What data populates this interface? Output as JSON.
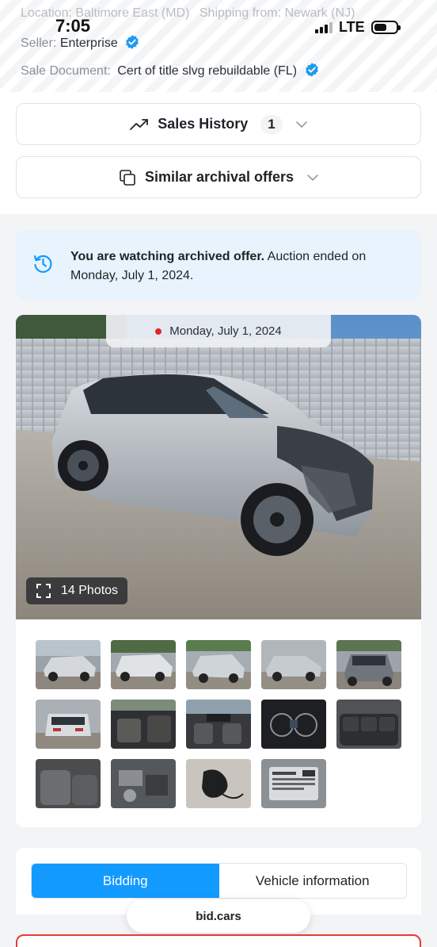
{
  "status_bar": {
    "time": "7:05",
    "network": "LTE"
  },
  "listing": {
    "location_label": "Location:",
    "location_value": "Baltimore East (MD)",
    "shipping_label": "Shipping from:",
    "shipping_value": "Newark (NJ)",
    "seller_label": "Seller:",
    "seller_value": "Enterprise",
    "document_label": "Sale Document:",
    "document_value": "Cert of title slvg rebuildable (FL)"
  },
  "accordions": {
    "sales_history_label": "Sales History",
    "sales_history_count": "1",
    "similar_offers_label": "Similar archival offers"
  },
  "notice": {
    "bold_text": "You are watching archived offer.",
    "text": " Auction ended on Monday, July 1, 2024."
  },
  "gallery": {
    "date": "Monday, July 1, 2024",
    "photos_label": "14 Photos",
    "thumbnails": [
      "front-left exterior",
      "left side exterior",
      "rear-left exterior",
      "front-right exterior",
      "front exterior",
      "rear exterior",
      "front interior",
      "front seats",
      "instrument cluster",
      "rear seats",
      "rear seat area",
      "engine bay",
      "key fob",
      "label sticker"
    ]
  },
  "tabs": {
    "bidding": "Bidding",
    "vehicle_info": "Vehicle information"
  },
  "browser": {
    "url": "bid.cars"
  },
  "colors": {
    "accent": "#139aff",
    "verified": "#1d9bf0",
    "notice_bg": "#e8f3fd",
    "live_dot": "#e0262b"
  }
}
